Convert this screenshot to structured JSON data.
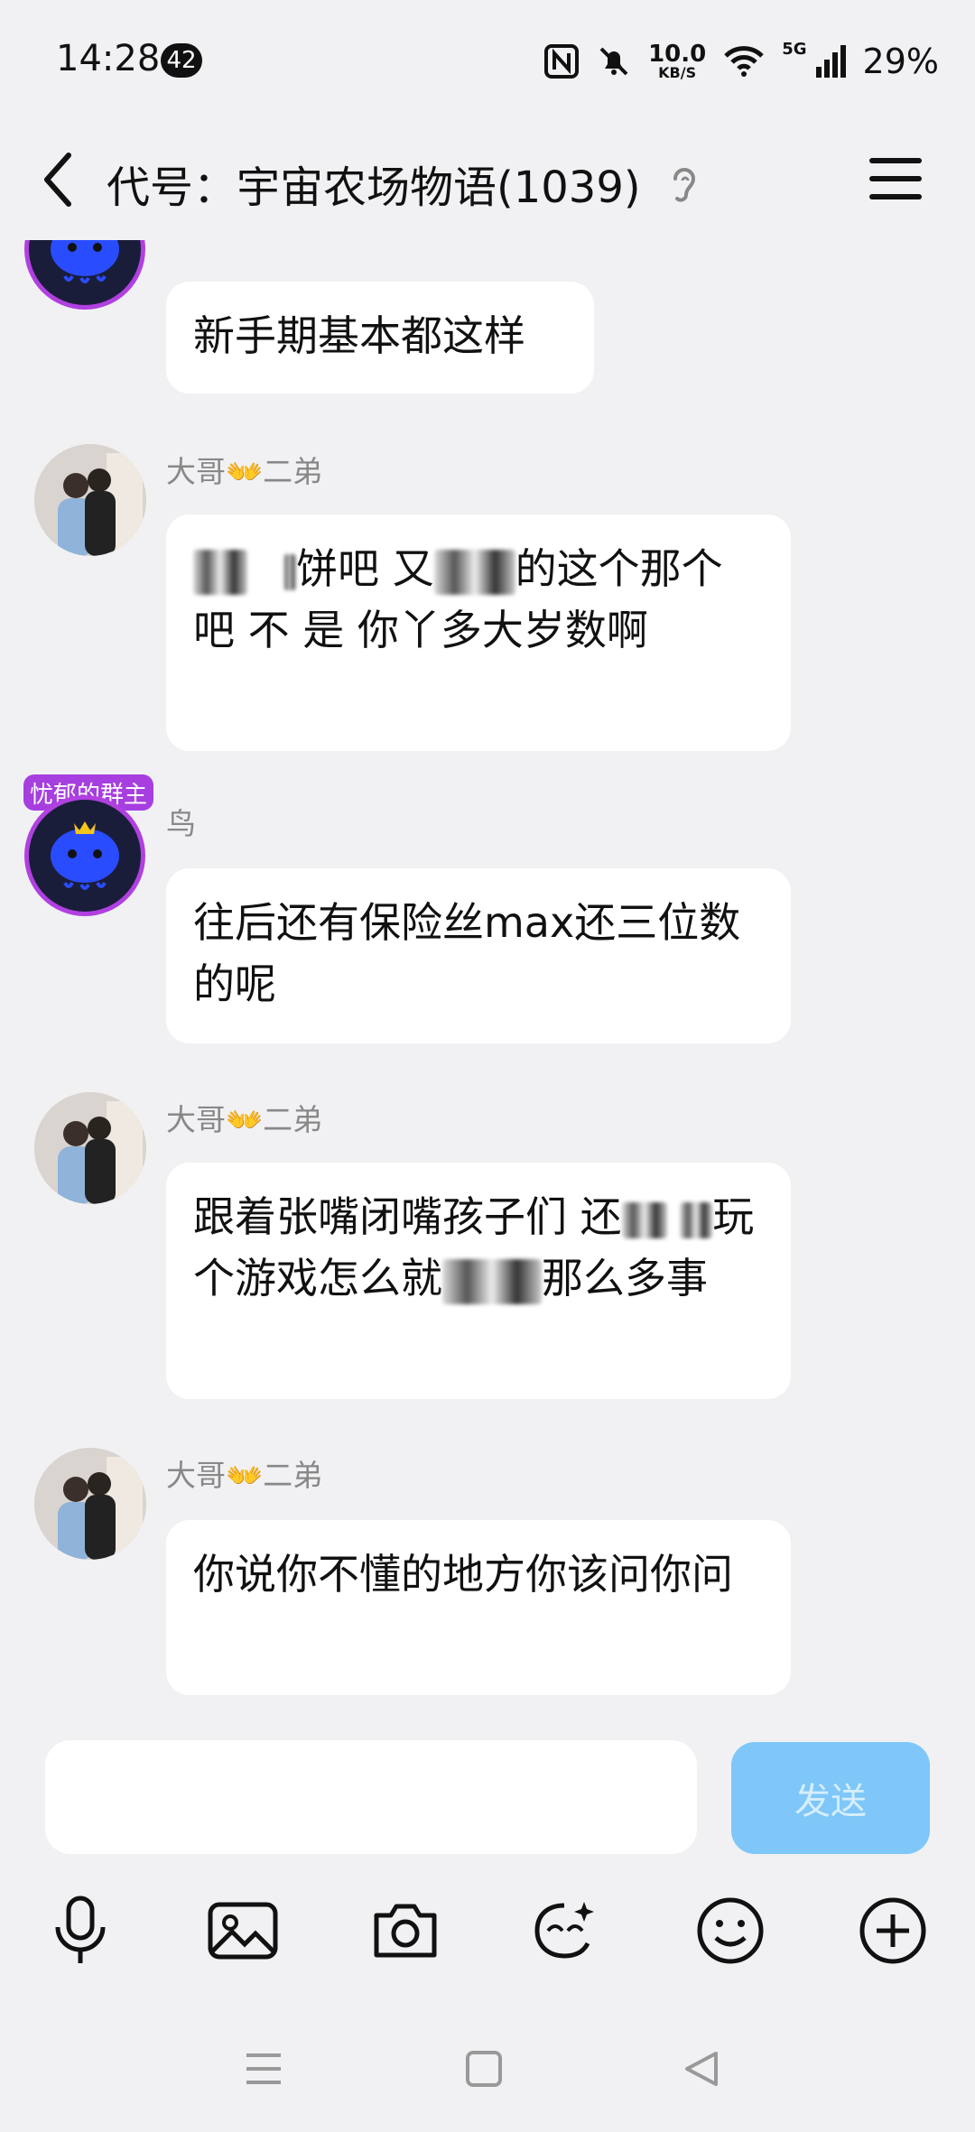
{
  "status_bar": {
    "time": "14:28",
    "notification_count": "42",
    "net_speed_value": "10.0",
    "net_speed_unit": "KB/S",
    "network": "5G",
    "battery": "29%"
  },
  "header": {
    "title": "代号：宇宙农场物语(1039)"
  },
  "messages": [
    {
      "sender": "",
      "text": "新手期基本都这样",
      "owner_tag": ""
    },
    {
      "sender": "大哥👐二弟",
      "text_parts": [
        "",
        "饼吧 又",
        "的这个那个吧  不 是 你丫多大岁数啊"
      ]
    },
    {
      "sender": "鸟",
      "owner_tag": "忧郁的群主",
      "text": "往后还有保险丝max还三位数的呢"
    },
    {
      "sender": "大哥👐二弟",
      "text_parts": [
        "跟着张嘴闭嘴孩子们 还",
        "玩个游戏怎么就",
        "那么多事"
      ]
    },
    {
      "sender": "大哥👐二弟",
      "text": "你说你不懂的地方你该问你问"
    }
  ],
  "input": {
    "placeholder": "",
    "send_label": "发送"
  },
  "colors": {
    "background": "#f1f1f4",
    "bubble": "#ffffff",
    "send_button": "#7ec7f8",
    "owner_tag": "#a63ee0",
    "avatar_ring": "#b040e0"
  },
  "icons": {
    "toolbar": [
      "microphone-icon",
      "image-icon",
      "camera-icon",
      "sticker-icon",
      "emoji-icon",
      "plus-icon"
    ],
    "nav": [
      "menu-nav-icon",
      "home-nav-icon",
      "back-nav-icon"
    ]
  }
}
